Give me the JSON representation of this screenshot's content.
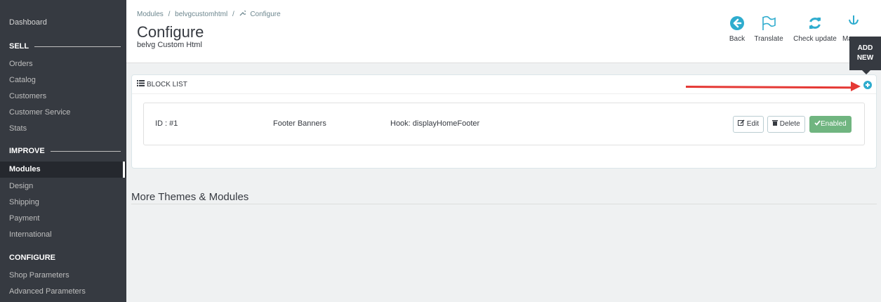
{
  "sidebar": {
    "dashboard": "Dashboard",
    "sections": {
      "sell": "SELL",
      "improve": "IMPROVE",
      "configure": "CONFIGURE"
    },
    "sell_items": [
      "Orders",
      "Catalog",
      "Customers",
      "Customer Service",
      "Stats"
    ],
    "improve_items": [
      "Modules",
      "Design",
      "Shipping",
      "Payment",
      "International"
    ],
    "configure_items": [
      "Shop Parameters",
      "Advanced Parameters"
    ],
    "active_item": "Modules"
  },
  "header": {
    "breadcrumb": [
      "Modules",
      "/",
      "belvgcustomhtml",
      "/",
      "Configure"
    ],
    "title": "Configure",
    "subtitle": "belvg Custom Html",
    "toolbar": {
      "back": "Back",
      "translate": "Translate",
      "check_update": "Check update",
      "manage": "Mana"
    },
    "tooltip_line1": "ADD",
    "tooltip_line2": "NEW"
  },
  "panel": {
    "title": "BLOCK LIST",
    "row": {
      "id": "ID : #1",
      "name": "Footer Banners",
      "hook": "Hook: displayHomeFooter",
      "edit": "Edit",
      "delete": "Delete",
      "status": "Enabled"
    }
  },
  "more_section": {
    "title": "More Themes & Modules"
  },
  "colors": {
    "sidebar_bg": "#363a41",
    "accent": "#2eacce",
    "enabled": "#70b580",
    "annotation_arrow": "#e53935"
  },
  "icons": [
    "back-icon",
    "translate-flag-icon",
    "refresh-icon",
    "anchor-icon",
    "list-icon",
    "add-circle-icon",
    "edit-icon",
    "trash-icon",
    "check-icon",
    "wrench-icon"
  ]
}
